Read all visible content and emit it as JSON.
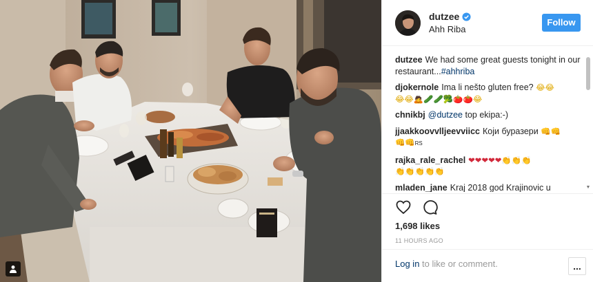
{
  "post": {
    "username": "dutzee",
    "location": "Ahh Riba",
    "follow_label": "Follow",
    "caption": {
      "user": "dutzee",
      "text": "We had some great guests tonight in our restaurant...",
      "hashtag": "#ahhriba"
    },
    "comments": [
      {
        "user": "djokernole",
        "text": "Ima li nešto gluten free?"
      },
      {
        "user": "chnikbj",
        "mention": "@dutzee",
        "text": "top ekipa:-)"
      },
      {
        "user": "jjaakkoovvlljeevviicc",
        "text": "Који буразери"
      },
      {
        "user": "rajka_rale_rachel",
        "text": ""
      },
      {
        "user": "mladen_jane",
        "text": "Kraj 2018 god Krajinovic u"
      }
    ],
    "likes": "1,698 likes",
    "time": "11 HOURS AGO",
    "login_prompt": {
      "link": "Log in",
      "rest": "to like or comment."
    },
    "more_label": "...",
    "icons": {
      "like": "heart-icon",
      "comment": "comment-icon",
      "verified": "verified-badge-icon",
      "tagged": "user-tag-icon"
    },
    "colors": {
      "accent": "#3897f0",
      "link": "#003569",
      "muted": "#999999",
      "border": "#efefef"
    }
  }
}
